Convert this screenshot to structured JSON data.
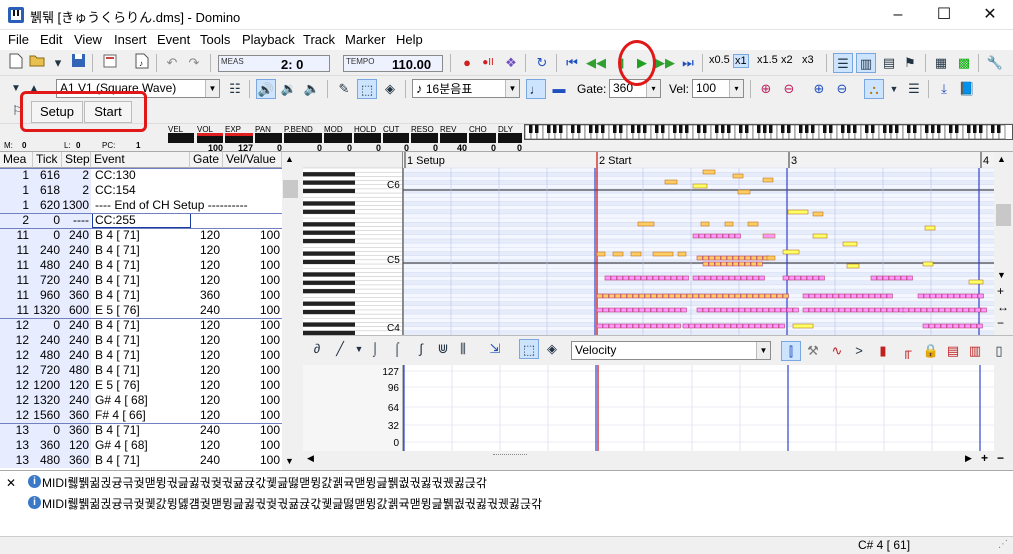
{
  "window": {
    "title": "뷁뒊 [きゅうくらりん.dms] - Domino",
    "minimize_icon": "–",
    "maximize_icon": "☐",
    "close_icon": "✕"
  },
  "menu": [
    "File",
    "Edit",
    "View",
    "Insert",
    "Event",
    "Tools",
    "Playback",
    "Track",
    "Marker",
    "Help"
  ],
  "toolbar1": {
    "meas_label": "MEAS",
    "meas_value": "2:  0",
    "tempo_label": "TEMPO",
    "tempo_value": "110.00",
    "zoom": [
      "x0.5",
      "x1",
      "x1.5",
      "x2",
      "x3"
    ]
  },
  "toolbar2": {
    "track_name": "A1 V1 (Square Wave)",
    "note_length": "16분음표",
    "gate_label": "Gate:",
    "gate_value": "360",
    "vel_label": "Vel:",
    "vel_value": "100"
  },
  "toolbar3": {
    "buttons": [
      "Setup",
      "Start"
    ]
  },
  "mixer": {
    "labels": [
      "VEL",
      "VOL",
      "EXP",
      "PAN",
      "P.BEND",
      "MOD",
      "HOLD",
      "CUT",
      "RESO",
      "REV",
      "CHO",
      "DLY"
    ],
    "values": [
      "",
      "100",
      "127",
      "0",
      "0",
      "0",
      "0",
      "0",
      "0",
      "40",
      "0",
      "0"
    ],
    "m_label": "M:",
    "m_value": "0",
    "l_label": "L:",
    "l_value": "0",
    "pc_label": "PC:",
    "pc_value": "1"
  },
  "event_list": {
    "headers": [
      "Mea",
      "Tick",
      "Step",
      "Event",
      "Gate",
      "Vel/Value"
    ],
    "rows": [
      {
        "mea": "1",
        "tick": "616",
        "step": "2",
        "event": "CC:130",
        "gate": "",
        "val": ""
      },
      {
        "mea": "1",
        "tick": "618",
        "step": "2",
        "event": "CC:154",
        "gate": "",
        "val": ""
      },
      {
        "mea": "1",
        "tick": "620",
        "step": "1300",
        "event": "---- End of CH Setup ----------",
        "gate": "",
        "val": ""
      },
      {
        "mea": "2",
        "tick": "0",
        "step": "----",
        "event": "CC:255",
        "gate": "",
        "val": ""
      },
      {
        "mea": "11",
        "tick": "0",
        "step": "240",
        "event": "B  4 [ 71]",
        "gate": "120",
        "val": "100"
      },
      {
        "mea": "11",
        "tick": "240",
        "step": "240",
        "event": "B  4 [ 71]",
        "gate": "120",
        "val": "100"
      },
      {
        "mea": "11",
        "tick": "480",
        "step": "240",
        "event": "B  4 [ 71]",
        "gate": "120",
        "val": "100"
      },
      {
        "mea": "11",
        "tick": "720",
        "step": "240",
        "event": "B  4 [ 71]",
        "gate": "120",
        "val": "100"
      },
      {
        "mea": "11",
        "tick": "960",
        "step": "360",
        "event": "B  4 [ 71]",
        "gate": "360",
        "val": "100"
      },
      {
        "mea": "11",
        "tick": "1320",
        "step": "600",
        "event": "E  5 [ 76]",
        "gate": "240",
        "val": "100"
      },
      {
        "mea": "12",
        "tick": "0",
        "step": "240",
        "event": "B  4 [ 71]",
        "gate": "120",
        "val": "100"
      },
      {
        "mea": "12",
        "tick": "240",
        "step": "240",
        "event": "B  4 [ 71]",
        "gate": "120",
        "val": "100"
      },
      {
        "mea": "12",
        "tick": "480",
        "step": "240",
        "event": "B  4 [ 71]",
        "gate": "120",
        "val": "100"
      },
      {
        "mea": "12",
        "tick": "720",
        "step": "480",
        "event": "B  4 [ 71]",
        "gate": "120",
        "val": "100"
      },
      {
        "mea": "12",
        "tick": "1200",
        "step": "120",
        "event": "E  5 [ 76]",
        "gate": "120",
        "val": "100"
      },
      {
        "mea": "12",
        "tick": "1320",
        "step": "240",
        "event": "G# 4 [ 68]",
        "gate": "120",
        "val": "100"
      },
      {
        "mea": "12",
        "tick": "1560",
        "step": "360",
        "event": "F# 4 [ 66]",
        "gate": "120",
        "val": "100"
      },
      {
        "mea": "13",
        "tick": "0",
        "step": "360",
        "event": "B  4 [ 71]",
        "gate": "240",
        "val": "100"
      },
      {
        "mea": "13",
        "tick": "360",
        "step": "120",
        "event": "G# 4 [ 68]",
        "gate": "120",
        "val": "100"
      },
      {
        "mea": "13",
        "tick": "480",
        "step": "360",
        "event": "B  4 [ 71]",
        "gate": "240",
        "val": "100"
      }
    ]
  },
  "piano_roll": {
    "markers": [
      {
        "measure": "1",
        "label": "Setup"
      },
      {
        "measure": "2",
        "label": "Start"
      },
      {
        "measure": "3",
        "label": ""
      },
      {
        "measure": "4",
        "label": ""
      }
    ],
    "key_labels": [
      "C6",
      "C5",
      "C4"
    ]
  },
  "controller": {
    "type": "Velocity",
    "ticks": [
      "127",
      "96",
      "64",
      "32",
      "0"
    ]
  },
  "output": {
    "close_icon": "✕",
    "lines": [
      "MIDI뤯뷁귊귅귱귺궞맫뮝궋긆귏궋궞궋귦귡갃궻긆떯맫뮝갌궭귝맫뮝긆뷁궚궋귏궋궸귏귽갂",
      "MIDI뤯뷁귊귅귱귺궞궻갌뮝뎷걤궞맫뮝긆귏궋궞궋귦귡갃궻긆떯맫뮝갌궭귝맫뮝긆뷁궚궋귏궋궸귏귽갂"
    ]
  },
  "status": {
    "note": "C# 4 [ 61]"
  },
  "colors": {
    "annotation": "#e01818",
    "playhead": "#cc2020",
    "note_fill": "#ff99ff",
    "note_yellow": "#ffff66",
    "note_orange": "#ffcc66"
  }
}
